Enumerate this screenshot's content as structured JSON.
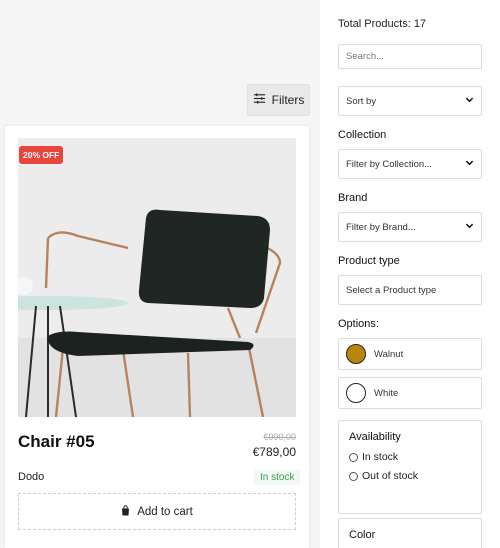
{
  "toolbar": {
    "filters_label": "Filters"
  },
  "product": {
    "badge": "20% OFF",
    "title": "Chair #05",
    "old_price": "€990,00",
    "price": "€789,00",
    "vendor": "Dodo",
    "stock": "In stock",
    "cart_label": "Add to cart"
  },
  "sidebar": {
    "total": "Total Products: 17",
    "search_placeholder": "Search...",
    "sort_value": "Sort by",
    "collection_label": "Collection",
    "collection_value": "Filter by Collection...",
    "brand_label": "Brand",
    "brand_value": "Filter by Brand...",
    "product_type_label": "Product type",
    "product_type_value": "Select a Product type",
    "options_label": "Options:",
    "options": [
      {
        "name": "Walnut",
        "color": "#b8860b"
      },
      {
        "name": "White",
        "color": "#ffffff"
      }
    ],
    "availability_label": "Availability",
    "availability_options": [
      "In stock",
      "Out of stock"
    ],
    "color_label": "Color"
  },
  "colors": {
    "badge": "#e8453c",
    "in_stock": "#3a9b52",
    "chair_seat": "#1f2624",
    "chair_frame": "#b6835c"
  }
}
